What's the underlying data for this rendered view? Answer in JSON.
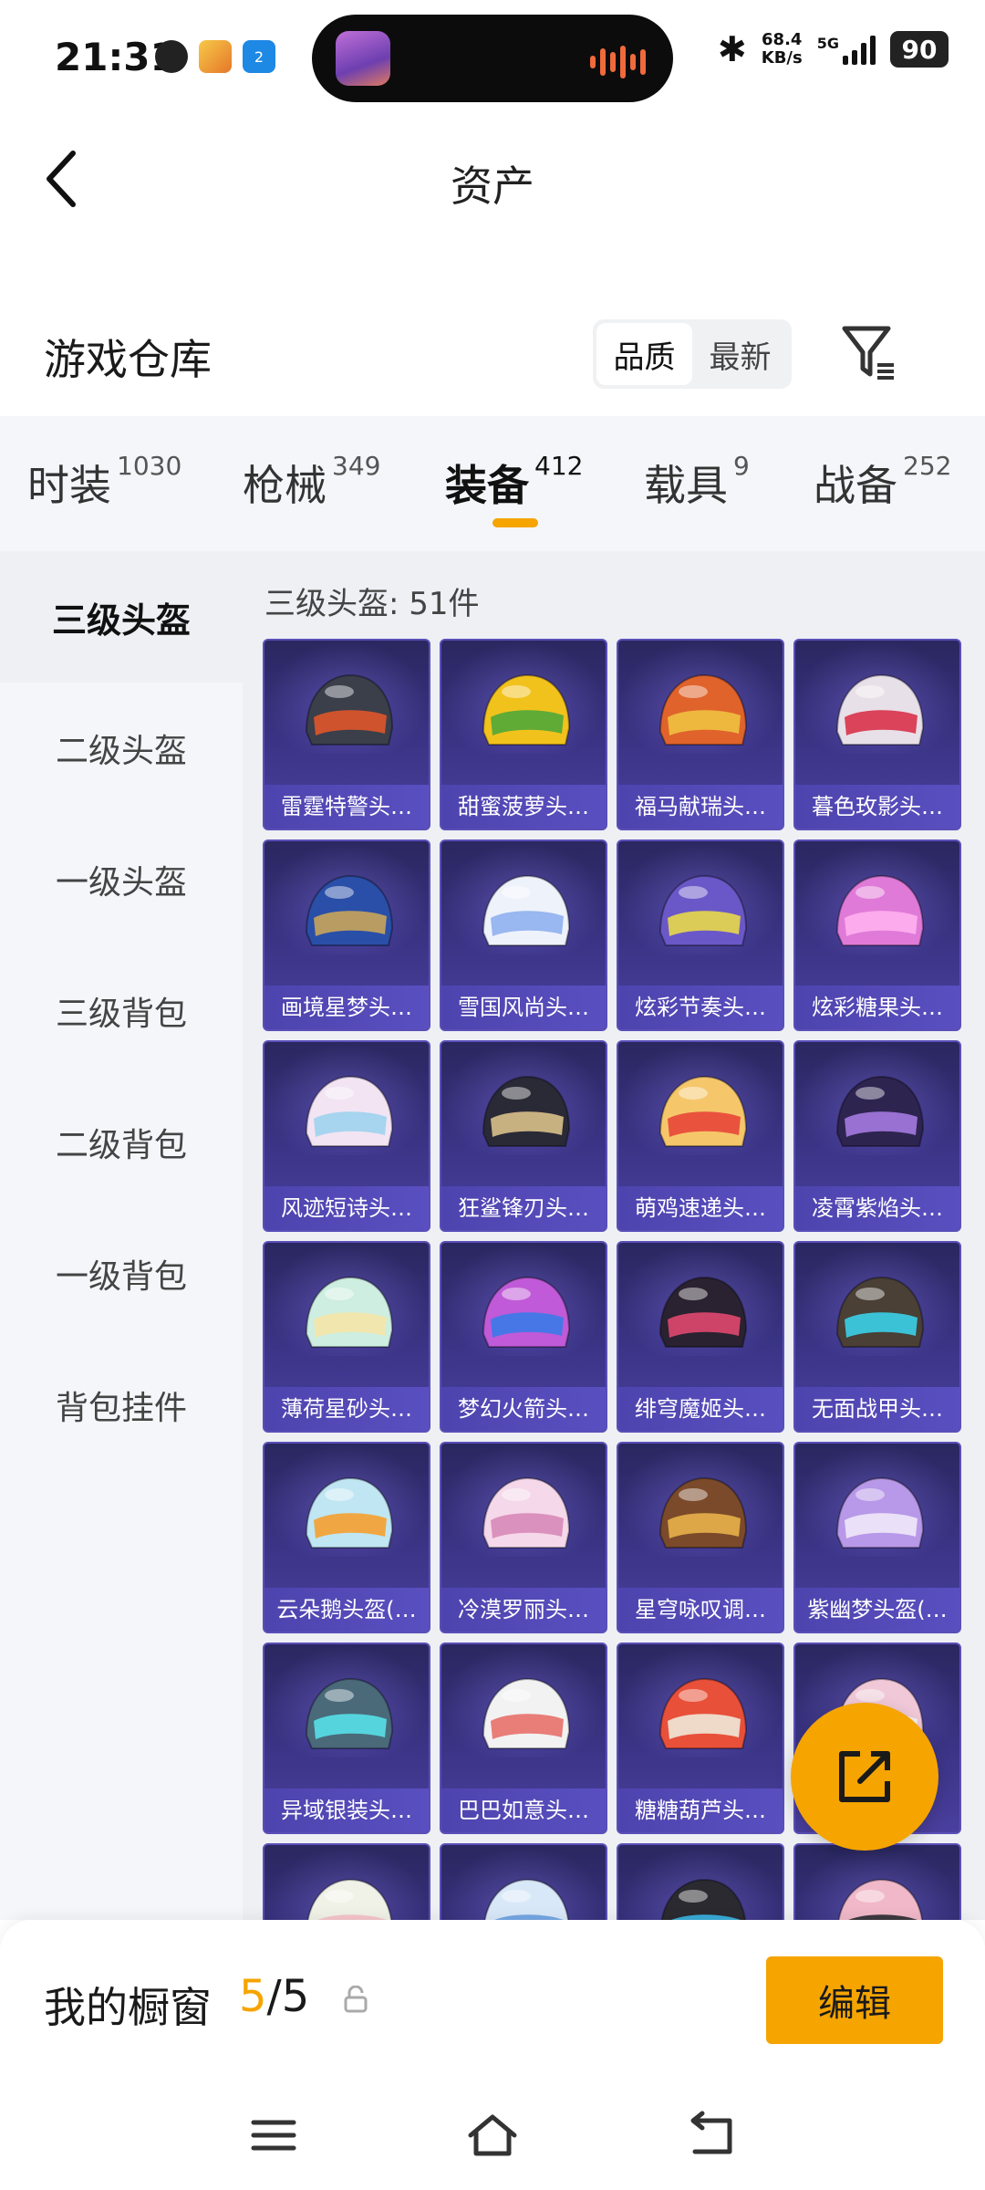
{
  "status": {
    "time": "21:31",
    "net_speed_value": "68.4",
    "net_speed_unit": "KB/s",
    "network": "5G",
    "battery": "90",
    "badge": "2"
  },
  "header": {
    "title": "资产"
  },
  "warehouse": {
    "title": "游戏仓库",
    "sort_options": [
      "品质",
      "最新"
    ],
    "sort_active": "品质"
  },
  "categories": [
    {
      "label": "时装",
      "count": "1030"
    },
    {
      "label": "枪械",
      "count": "349"
    },
    {
      "label": "装备",
      "count": "412"
    },
    {
      "label": "载具",
      "count": "9"
    },
    {
      "label": "战备",
      "count": "252"
    }
  ],
  "active_category": "装备",
  "sidebar": {
    "items": [
      "三级头盔",
      "二级头盔",
      "一级头盔",
      "三级背包",
      "二级背包",
      "一级背包",
      "背包挂件"
    ],
    "active": "三级头盔"
  },
  "content": {
    "count_line": "三级头盔: 51件",
    "items": [
      {
        "name": "雷霆特警头…",
        "c1": "#3a3f4a",
        "c2": "#e0552a"
      },
      {
        "name": "甜蜜菠萝头…",
        "c1": "#f2c21c",
        "c2": "#4fa83a"
      },
      {
        "name": "福马献瑞头…",
        "c1": "#e0632b",
        "c2": "#f0c040"
      },
      {
        "name": "暮色玫影头…",
        "c1": "#e8e0e8",
        "c2": "#d8324a"
      },
      {
        "name": "画境星梦头…",
        "c1": "#2a4fa8",
        "c2": "#c9a45a"
      },
      {
        "name": "雪国风尚头…",
        "c1": "#eef2fb",
        "c2": "#8fb0ee"
      },
      {
        "name": "炫彩节奏头…",
        "c1": "#6a58c8",
        "c2": "#e8d84a"
      },
      {
        "name": "炫彩糖果头…",
        "c1": "#e07ad8",
        "c2": "#ffb0f0"
      },
      {
        "name": "风迹短诗头…",
        "c1": "#f2e4f2",
        "c2": "#9ed2ee"
      },
      {
        "name": "狂鲨锋刃头…",
        "c1": "#2a2a36",
        "c2": "#d9c08a"
      },
      {
        "name": "萌鸡速递头…",
        "c1": "#f5c76a",
        "c2": "#e8463a"
      },
      {
        "name": "凌霄紫焰头…",
        "c1": "#2e2450",
        "c2": "#a57ae0"
      },
      {
        "name": "薄荷星砂头…",
        "c1": "#cdeee0",
        "c2": "#f5e6a8"
      },
      {
        "name": "梦幻火箭头…",
        "c1": "#c05ad8",
        "c2": "#3a7ae8"
      },
      {
        "name": "绯穹魔姬头…",
        "c1": "#2a2230",
        "c2": "#e04870"
      },
      {
        "name": "无面战甲头…",
        "c1": "#4a4036",
        "c2": "#3ad0e8"
      },
      {
        "name": "云朵鹅头盔(…",
        "c1": "#bfe6f2",
        "c2": "#f5a030"
      },
      {
        "name": "冷漠罗丽头…",
        "c1": "#f5d8ea",
        "c2": "#d88ab8"
      },
      {
        "name": "星穹咏叹调…",
        "c1": "#7a4a2a",
        "c2": "#e8b04a"
      },
      {
        "name": "紫幽梦头盔(…",
        "c1": "#b898e8",
        "c2": "#f0e8f8"
      },
      {
        "name": "异域银装头…",
        "c1": "#4a6a7a",
        "c2": "#58e0e8"
      },
      {
        "name": "巴巴如意头…",
        "c1": "#f2f2f2",
        "c2": "#e8706a"
      },
      {
        "name": "糖糖葫芦头…",
        "c1": "#e8503a",
        "c2": "#f0e8d8"
      },
      {
        "name": "",
        "c1": "#f0c8d8",
        "c2": "#f5f5f5"
      },
      {
        "name": "",
        "c1": "#f0f2e8",
        "c2": "#f5c0c8"
      },
      {
        "name": "",
        "c1": "#d8e8f8",
        "c2": "#6aa0e0"
      },
      {
        "name": "",
        "c1": "#2a2a30",
        "c2": "#3ab8e8"
      },
      {
        "name": "",
        "c1": "#f0b8c8",
        "c2": "#2a2a30"
      }
    ]
  },
  "showcase": {
    "label": "我的橱窗",
    "current": "5",
    "total": "/5",
    "edit_label": "编辑"
  },
  "colors": {
    "accent": "#f5a400",
    "card_bg": "#3b3486",
    "label_bg": "#5a4fc0"
  }
}
